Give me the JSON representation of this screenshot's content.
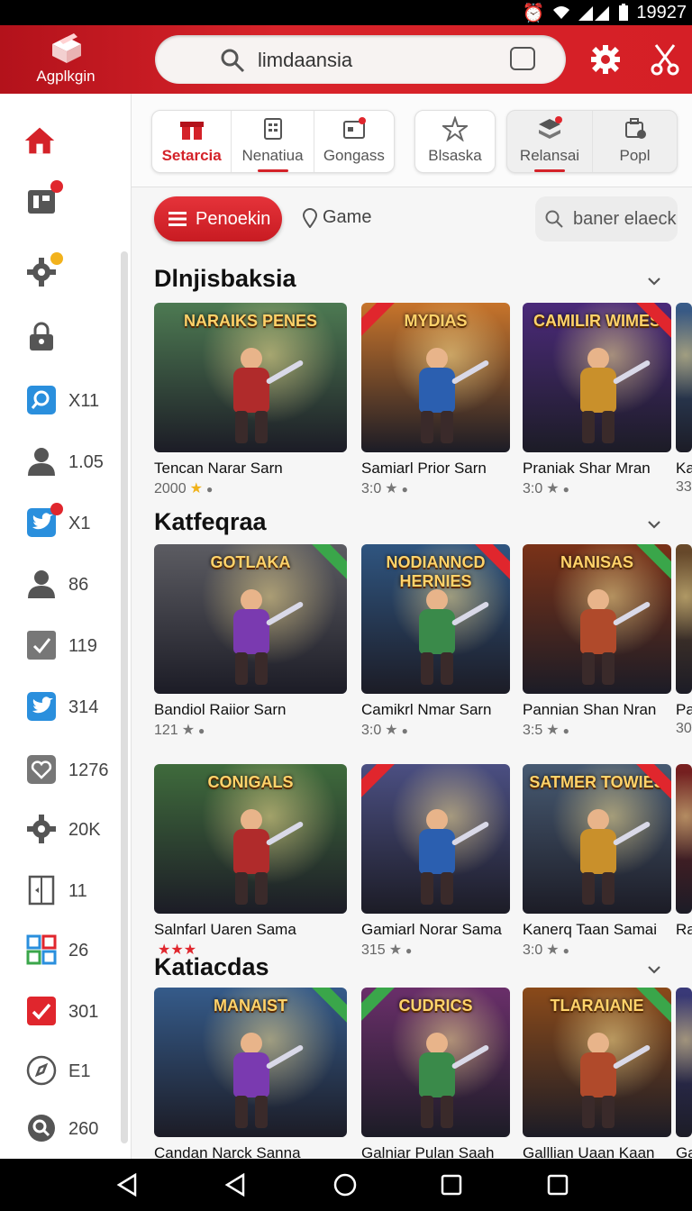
{
  "status": {
    "time": "19927"
  },
  "app": {
    "name": "Agplkgin"
  },
  "search": {
    "value": "limdaansia"
  },
  "sidebar": {
    "items": [
      {
        "icon": "home-icon",
        "value": "",
        "badge": false
      },
      {
        "icon": "store-icon",
        "value": "",
        "badge": true
      },
      {
        "icon": "gear-icon",
        "value": "",
        "badge": true
      },
      {
        "icon": "lock-icon",
        "value": "",
        "badge": false
      },
      {
        "icon": "search-icon",
        "value": "X11",
        "badge": false
      },
      {
        "icon": "person-icon",
        "value": "1.05",
        "badge": false
      },
      {
        "icon": "bird-icon",
        "value": "X1",
        "badge": true
      },
      {
        "icon": "person-icon",
        "value": "86",
        "badge": false
      },
      {
        "icon": "check-icon",
        "value": "119",
        "badge": false
      },
      {
        "icon": "bird-icon",
        "value": "314",
        "badge": false
      },
      {
        "icon": "heart-icon",
        "value": "1276",
        "badge": false
      },
      {
        "icon": "gear-icon",
        "value": "20K",
        "badge": false
      },
      {
        "icon": "door-icon",
        "value": "11",
        "badge": false
      },
      {
        "icon": "grid-icon",
        "value": "26",
        "badge": false
      },
      {
        "icon": "check-box-icon",
        "value": "301",
        "badge": false
      },
      {
        "icon": "compass-icon",
        "value": "E1",
        "badge": false
      },
      {
        "icon": "search-icon",
        "value": "260",
        "badge": false
      }
    ]
  },
  "tabs": [
    {
      "label": "Setarcia",
      "icon": "gift-icon",
      "active": true
    },
    {
      "label": "Nenatiua",
      "icon": "list-icon",
      "active": false
    },
    {
      "label": "Gongass",
      "icon": "calendar-icon",
      "active": false
    },
    {
      "label": "Blsaska",
      "icon": "star-icon",
      "active": false
    },
    {
      "label": "Relansai",
      "icon": "stack-icon",
      "active": false
    },
    {
      "label": "Popl",
      "icon": "briefcase-icon",
      "active": false
    }
  ],
  "filter": {
    "label": "Penoekin",
    "game_label": "Game",
    "search_placeholder": "baner elaeck"
  },
  "sections": [
    {
      "title": "Dlnjisbaksia",
      "cards": [
        {
          "name": "Tencan Narar Sarn",
          "meta": "2000",
          "thumb_title": "NARAIKS PENES",
          "theme": "#4d7a52"
        },
        {
          "name": "Samiarl Prior Sarn",
          "meta": "3:0",
          "thumb_title": "MYDIAS",
          "theme": "#c7742b"
        },
        {
          "name": "Praniak Shar Mran",
          "meta": "3:0",
          "thumb_title": "CAMILIR WIMES",
          "theme": "#4b2a7a"
        },
        {
          "name": "Ka",
          "meta": "33",
          "thumb_title": "",
          "theme": "#3a5d8a"
        }
      ]
    },
    {
      "title": "Katfeqraa",
      "cards": [
        {
          "name": "Bandiol Raiior Sarn",
          "meta": "121",
          "thumb_title": "GOTLAKA",
          "theme": "#5c5c62"
        },
        {
          "name": "Camikrl Nmar Sarn",
          "meta": "3:0",
          "thumb_title": "NODIANNCD HERNIES",
          "theme": "#2f5580"
        },
        {
          "name": "Pannian Shan Nran",
          "meta": "3:5",
          "thumb_title": "NANISAS",
          "theme": "#7a3218"
        },
        {
          "name": "Pa",
          "meta": "30",
          "thumb_title": "",
          "theme": "#6a4a2a"
        }
      ]
    },
    {
      "title": "",
      "cards": [
        {
          "name": "Salnfarl Uaren Sama",
          "meta": "",
          "thumb_title": "CONIGALS",
          "theme": "#3f6b3c"
        },
        {
          "name": "Gamiarl Norar Sama",
          "meta": "315",
          "thumb_title": "",
          "theme": "#4b4f82"
        },
        {
          "name": "Kanerq Taan Samai",
          "meta": "3:0",
          "thumb_title": "SATMER TOWIES",
          "theme": "#475a72"
        },
        {
          "name": "Ra",
          "meta": "",
          "thumb_title": "",
          "theme": "#7a2020"
        }
      ]
    },
    {
      "title": "Katiacdas",
      "cards": [
        {
          "name": "Candan Narck Sanna",
          "meta": "",
          "thumb_title": "MANAIST",
          "theme": "#355b8a"
        },
        {
          "name": "Galniar Pulan Saah",
          "meta": "",
          "thumb_title": "CUDRICS",
          "theme": "#6a2f6a"
        },
        {
          "name": "Galllian Uaan Kaan",
          "meta": "",
          "thumb_title": "TLARAIANE",
          "theme": "#8a4a1a"
        },
        {
          "name": "Ga",
          "meta": "",
          "thumb_title": "",
          "theme": "#3a3a7a"
        }
      ]
    }
  ],
  "colors": {
    "brand_red": "#d42229",
    "accent": "#e0262d"
  }
}
